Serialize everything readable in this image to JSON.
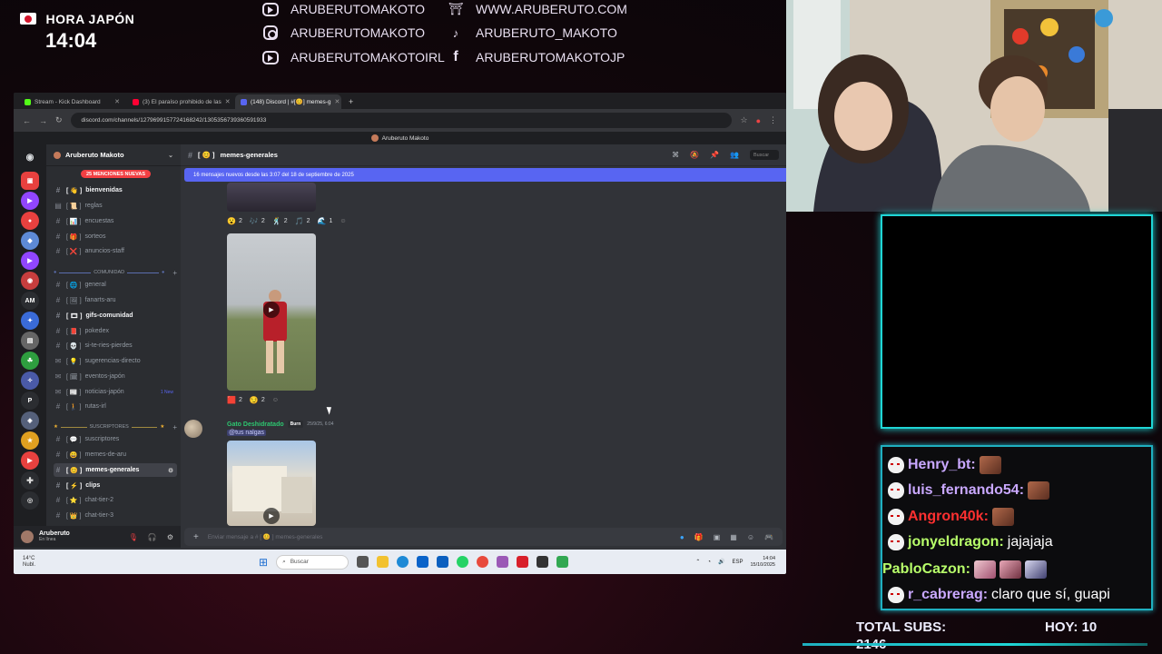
{
  "overlay": {
    "clock_label": "HORA JAPÓN",
    "clock_time": "14:04",
    "socials": [
      {
        "icon": "youtube-icon",
        "text": "ARUBERUTOMAKOTO"
      },
      {
        "icon": "website-icon",
        "text": "WWW.ARUBERUTO.COM"
      },
      {
        "icon": "instagram-icon",
        "text": "ARUBERUTOMAKOTO"
      },
      {
        "icon": "tiktok-icon",
        "text": "ARUBERUTO_MAKOTO"
      },
      {
        "icon": "youtube-icon",
        "text": "ARUBERUTOMAKOTOIRL"
      },
      {
        "icon": "facebook-icon",
        "text": "ARUBERUTOMAKOTOJP"
      }
    ]
  },
  "browser": {
    "tabs": [
      {
        "label": "Stream - Kick Dashboard",
        "color": "#53fc18"
      },
      {
        "label": "(3) El paraíso prohibido de las",
        "color": "#ff0033"
      },
      {
        "label": "(148) Discord | #[😊] memes-g",
        "color": "#5865f2"
      }
    ],
    "url": "discord.com/channels/1279699157724168242/1305356739360591933",
    "title": "Aruberuto Makoto"
  },
  "discord": {
    "server_name": "Aruberuto Makoto",
    "mentions_badge": "25 MENCIONES NUEVAS",
    "channels": [
      {
        "name": "bienvenidas",
        "bold": true,
        "prefix": "[ 👋 ]"
      },
      {
        "name": "reglas",
        "bold": false,
        "prefix": "[ 📜 ]"
      },
      {
        "name": "encuestas",
        "bold": false,
        "prefix": "[ 📊 ]"
      },
      {
        "name": "sorteos",
        "bold": false,
        "prefix": "[ 🎁 ]"
      },
      {
        "name": "anuncios-staff",
        "bold": false,
        "prefix": "[ ❌ ]"
      }
    ],
    "category_comunidad": "COMUNIDAD",
    "community_channels": [
      {
        "name": "general",
        "bold": false,
        "prefix": "[ 🌐 ]"
      },
      {
        "name": "fanarts-aru",
        "bold": false,
        "prefix": "[ 🖼 ]"
      },
      {
        "name": "gifs-comunidad",
        "bold": true,
        "prefix": "[ 🎞 ]"
      },
      {
        "name": "pokedex",
        "bold": false,
        "prefix": "[ 📕 ]"
      },
      {
        "name": "si-te-ries-pierdes",
        "bold": false,
        "prefix": "[ 💀 ]"
      },
      {
        "name": "sugerencias-directo",
        "bold": false,
        "prefix": "[ 💡 ]"
      },
      {
        "name": "eventos-japón",
        "bold": false,
        "prefix": "[ 🗓 ]"
      },
      {
        "name": "noticias-japón",
        "bold": false,
        "prefix": "[ 📰 ]",
        "new": "1 New"
      },
      {
        "name": "rutas-irl",
        "bold": false,
        "prefix": "[ 🚶 ]"
      }
    ],
    "category_suscriptores": "SUSCRIPTORES",
    "sub_channels": [
      {
        "name": "suscriptores",
        "bold": false,
        "prefix": "[ 💬 ]"
      },
      {
        "name": "memes-de-aru",
        "bold": false,
        "prefix": "[ 😄 ]"
      },
      {
        "name": "memes-generales",
        "bold": true,
        "prefix": "[ 😊 ]",
        "selected": true
      },
      {
        "name": "clips",
        "bold": true,
        "prefix": "[ ⚡ ]"
      },
      {
        "name": "chat-tier-2",
        "bold": false,
        "prefix": "[ ⭐ ]"
      },
      {
        "name": "chat-tier-3",
        "bold": false,
        "prefix": "[ 👑 ]"
      }
    ],
    "user": {
      "name": "Aruberuto",
      "status": "En línea"
    },
    "channel_header": {
      "prefix": "[ 😊 ]",
      "name": "memes-generales",
      "search": "Buscar"
    },
    "new_messages_bar": "16 mensajes nuevos desde las 3:07 del 18 de septiembre de 2025",
    "reactions_1": [
      {
        "emoji": "😮",
        "count": "2"
      },
      {
        "emoji": "🎶",
        "count": "2"
      },
      {
        "emoji": "🕺",
        "count": "2"
      },
      {
        "emoji": "🎵",
        "count": "2"
      },
      {
        "emoji": "🌊",
        "count": "1"
      }
    ],
    "reactions_2": [
      {
        "emoji": "🟥",
        "count": "2"
      },
      {
        "emoji": "😏",
        "count": "2"
      }
    ],
    "message": {
      "author": "Gato Deshidratado",
      "badge": "Burn",
      "timestamp": "25/9/25, 6:04",
      "mention": "@tus nalgas"
    },
    "composer_placeholder": "Enviar mensaje a # [ 😊 ] memes-generales"
  },
  "taskbar": {
    "weather_temp": "14°C",
    "weather_desc": "Nubl.",
    "search": "Buscar",
    "lang": "ESP",
    "time": "14:04",
    "date": "15/10/2025"
  },
  "stream_chat": [
    {
      "user": "Henry_bt:",
      "color": "#c9a8ff",
      "text": "",
      "emote": true
    },
    {
      "user": "luis_fernando54:",
      "color": "#c9a8ff",
      "text": "",
      "emote": true
    },
    {
      "user": "Angron40k:",
      "color": "#ff3030",
      "text": "",
      "emote": true
    },
    {
      "user": "jonyeldragon:",
      "color": "#b8ff6a",
      "text": "jajajaja",
      "emote": false
    },
    {
      "user": "PabloCazon:",
      "color": "#b8ff6a",
      "text": "",
      "emote": true
    },
    {
      "user": "r_cabrerag:",
      "color": "#c9a8ff",
      "text": "claro que sí, guapi",
      "emote": false
    }
  ],
  "stats": {
    "total_subs_label": "TOTAL SUBS:",
    "total_subs_value": "2146",
    "today_label": "HOY:",
    "today_value": "10"
  }
}
